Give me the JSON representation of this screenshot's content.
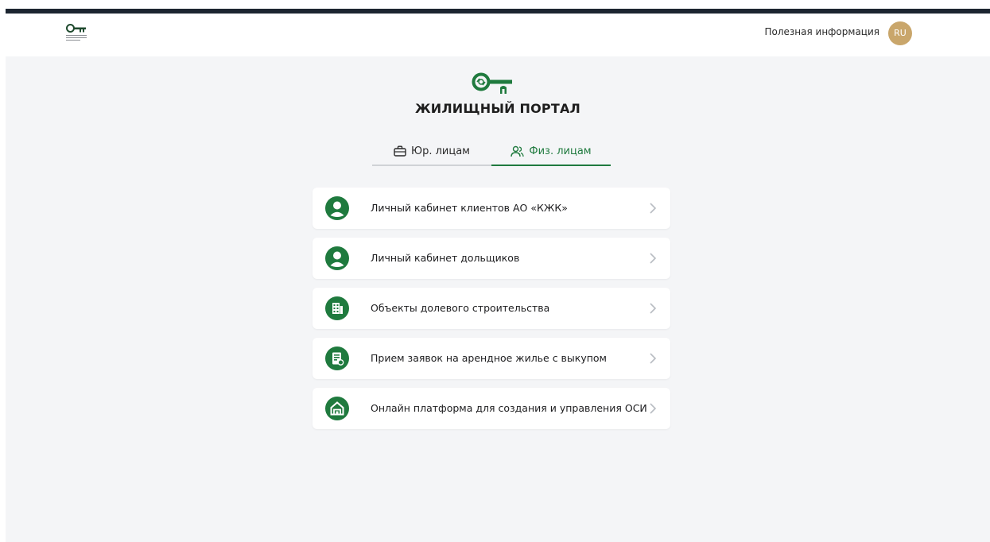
{
  "header": {
    "useful_info": "Полезная информация",
    "lang": "RU"
  },
  "portal": {
    "title": "ЖИЛИЩНЫЙ ПОРТАЛ"
  },
  "tabs": [
    {
      "label": "Юр. лицам",
      "icon": "briefcase-icon",
      "active": false
    },
    {
      "label": "Физ. лицам",
      "icon": "users-icon",
      "active": true
    }
  ],
  "services": [
    {
      "label": "Личный кабинет клиентов АО «КЖК»",
      "icon": "user-circle-icon"
    },
    {
      "label": "Личный кабинет дольщиков",
      "icon": "user-circle-icon"
    },
    {
      "label": "Объекты долевого строительства",
      "icon": "building-icon"
    },
    {
      "label": "Прием заявок на арендное жилье с выкупом",
      "icon": "application-document-icon"
    },
    {
      "label": "Онлайн платформа для создания и управления ОСИ",
      "icon": "house-icon"
    }
  ],
  "colors": {
    "brand_green": "#1f7a3e",
    "badge_gold": "#c9a66b",
    "background": "#f4f5f7"
  }
}
